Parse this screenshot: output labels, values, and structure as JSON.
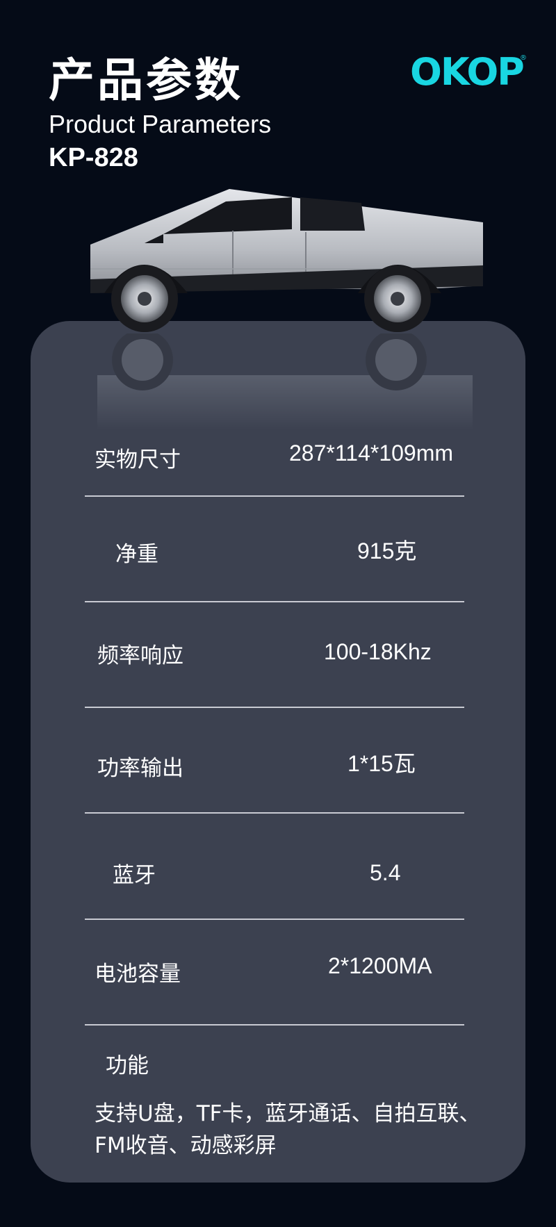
{
  "header": {
    "title_cn": "产品参数",
    "title_en": "Product Parameters",
    "model": "KP-828",
    "logo_text": "OKOP",
    "logo_mark": "®",
    "accent_color": "#19d6e2"
  },
  "specs": [
    {
      "label": "实物尺寸",
      "value": "287*114*109mm"
    },
    {
      "label": "净重",
      "value": "915克"
    },
    {
      "label": "频率响应",
      "value": "100-18Khz"
    },
    {
      "label": "功率输出",
      "value": "1*15瓦"
    },
    {
      "label": "蓝牙",
      "value": "5.4"
    },
    {
      "label": "电池容量",
      "value": "2*1200MA"
    }
  ],
  "features": {
    "label": "功能",
    "text": "支持U盘，TF卡，蓝牙通话、自拍互联、FM收音、动感彩屏"
  }
}
